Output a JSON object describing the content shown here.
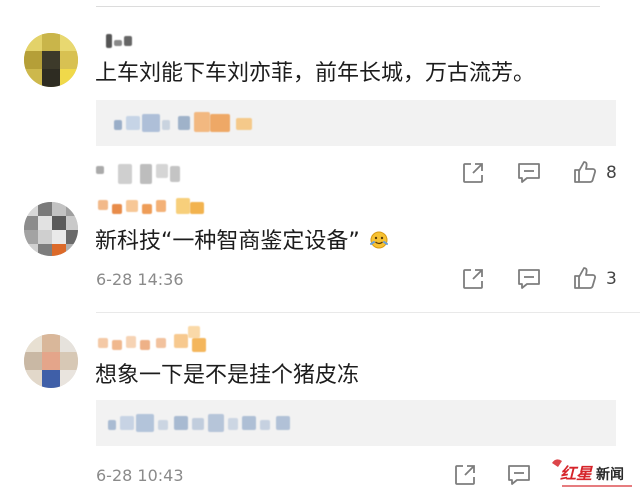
{
  "comments": [
    {
      "text": "上车刘能下车刘亦菲，前年长城，万古流芳。",
      "time": "",
      "likes": "8"
    },
    {
      "text": "新科技“一种智商鉴定设备”",
      "time": "6-28 14:36",
      "likes": "3"
    },
    {
      "text": "想象一下是不是挂个猪皮冻",
      "time": "6-28 10:43",
      "likes": ""
    }
  ],
  "icons": {
    "share": "share-icon",
    "comment": "comment-icon",
    "like": "thumbs-up-icon",
    "emoji": "emoji-icon"
  },
  "watermark": {
    "brand": "红星新闻"
  },
  "colors": {
    "accent": "#f08a24",
    "watermark": "#d6242a",
    "icon": "#7d7d7d"
  }
}
